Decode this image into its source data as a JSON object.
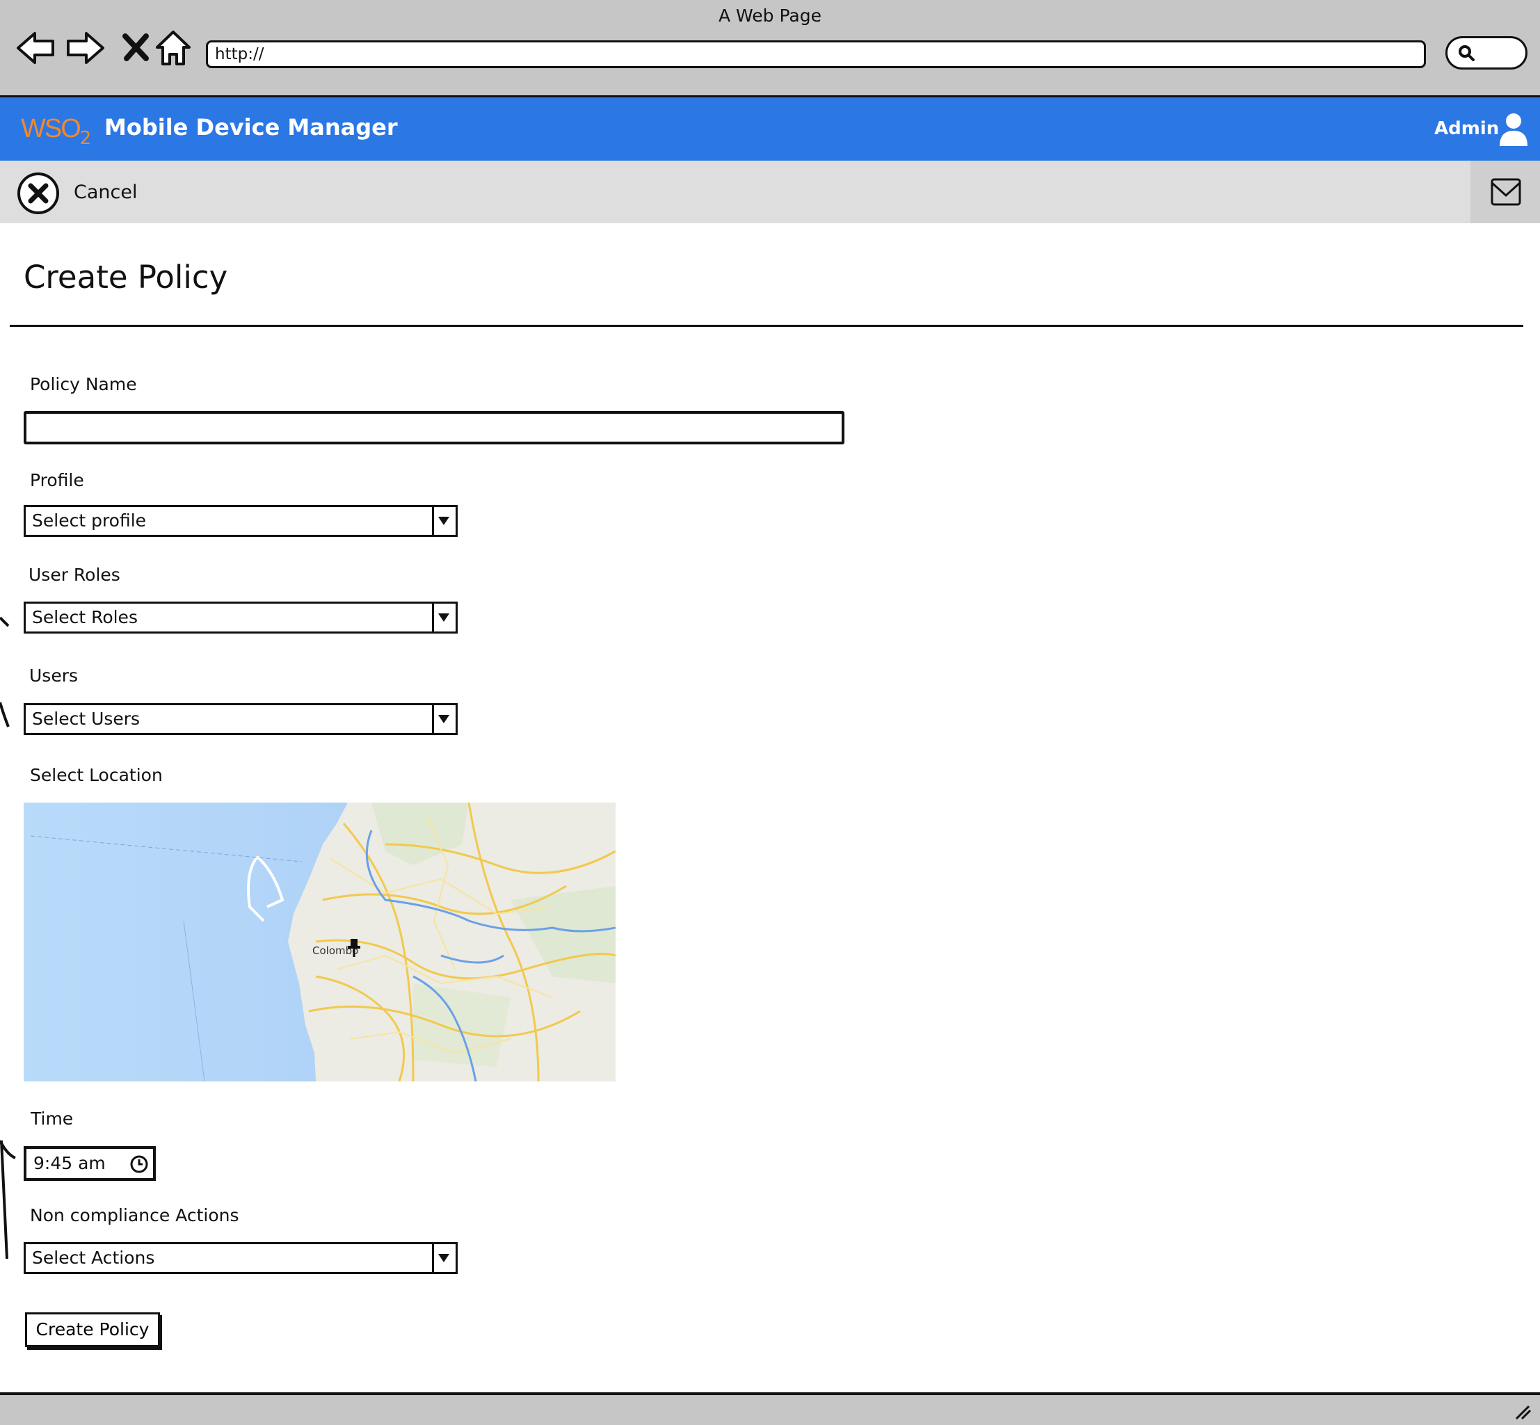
{
  "browser": {
    "title": "A Web Page",
    "url": "http://"
  },
  "header": {
    "logo_text": "WSO",
    "logo_sub": "2",
    "app_title": "Mobile Device Manager",
    "user_label": "Admin",
    "accent_color": "#2b77e4"
  },
  "toolbar": {
    "cancel_label": "Cancel"
  },
  "page": {
    "title": "Create Policy"
  },
  "form": {
    "policy_name_label": "Policy Name",
    "policy_name_value": "",
    "profile_label": "Profile",
    "profile_value": "Select profile",
    "roles_label": "User Roles",
    "roles_value": "Select Roles",
    "users_label": "Users",
    "users_value": "Select Users",
    "location_label": "Select Location",
    "map_place": "Colombo",
    "time_label": "Time",
    "time_value": "9:45 am",
    "actions_label": "Non compliance Actions",
    "actions_value": "Select Actions",
    "submit_label": "Create Policy"
  },
  "icons": {
    "back": "back-arrow-icon",
    "forward": "forward-arrow-icon",
    "stop": "stop-x-icon",
    "home": "home-icon",
    "search": "search-icon",
    "user": "user-icon",
    "cancel": "close-circle-icon",
    "mail": "mail-icon",
    "clock": "clock-icon",
    "dropdown": "chevron-down-icon",
    "pin": "map-pin-icon"
  }
}
